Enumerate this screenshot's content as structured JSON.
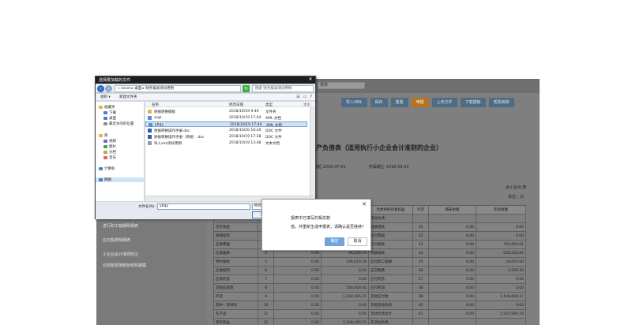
{
  "app": {
    "tab_input": "报表",
    "toolbar": [
      {
        "label": "导入XML",
        "active": false
      },
      {
        "label": "保存",
        "active": false
      },
      {
        "label": "重置",
        "active": false
      },
      {
        "label": "申报",
        "active": true
      },
      {
        "label": "上传文件",
        "active": false
      },
      {
        "label": "下载模板",
        "active": false
      },
      {
        "label": "帮助转换",
        "active": false
      }
    ],
    "left_menu": [
      "进行职工薪酬明细表",
      "应交税费明细表",
      "小企业会计准则附注",
      "应收账款按账龄结构披露"
    ],
    "report_title": "产负债表（适用执行小企业会计准则的企业）",
    "meta": {
      "date": "报期起  2018-07-01",
      "period": "所属期止  2018-09-30",
      "form": "会小企01表",
      "unit": "单位：元"
    },
    "table": {
      "header": [
        "",
        "行次",
        "期末余额",
        "年初余额",
        "负债和所有者权益",
        "行次",
        "期末余额",
        "年初余额"
      ],
      "rows": [
        [
          "",
          "",
          "",
          "",
          "流动负债：",
          "",
          "",
          ""
        ],
        [
          "货币资金",
          "1",
          "",
          "",
          "短期借款",
          "31",
          "0.00",
          "0.00"
        ],
        [
          "短期投资",
          "2",
          "",
          "",
          "应付票据",
          "32",
          "0.00",
          "0.00"
        ],
        [
          "应收票据",
          "3",
          "",
          "",
          "应付账款",
          "33",
          "0.00",
          "750,950.61"
        ],
        [
          "应收账款",
          "4",
          "0.00",
          "96,258.19",
          "预收账款",
          "34",
          "0.00",
          "635,564.81"
        ],
        [
          "预付账款",
          "5",
          "0.00",
          "106,019.19",
          "应付职工薪酬",
          "35",
          "0.00",
          "16,655.00"
        ],
        [
          "应收股利",
          "6",
          "0.00",
          "0.00",
          "应交税费",
          "36",
          "0.00",
          "-1,929.20"
        ],
        [
          "应收利息",
          "7",
          "0.00",
          "0.00",
          "应付利息",
          "37",
          "0.00",
          "0.00"
        ],
        [
          "其他应收款",
          "8",
          "0.00",
          "500,000.00",
          "应付利润",
          "38",
          "0.00",
          "0.00"
        ],
        [
          "存货",
          "9",
          "0.00",
          "1,204,416.15",
          "其他应付款",
          "39",
          "0.00",
          "1,146,699.17"
        ],
        [
          "其中：原材料",
          "10",
          "0.00",
          "0.00",
          "其他流动负债",
          "40",
          "0.00",
          "0.00"
        ],
        [
          "在产品",
          "11",
          "0.00",
          "0.00",
          "流动负债合计",
          "41",
          "0.00",
          "2,547,940.19"
        ],
        [
          "库存商品",
          "12",
          "0.00",
          "1,204,416.15",
          "非流动负债：",
          "",
          "",
          ""
        ]
      ]
    }
  },
  "file_dialog": {
    "title": "选择要加载的文件",
    "address": "« excel ▸ 桌面 ▸ 财务报表测试用例",
    "search_placeholder": "搜索 财务报表测试用例",
    "cmd_organize": "组织 ▾",
    "cmd_newfolder": "新建文件夹",
    "tree": [
      {
        "label": "收藏夹",
        "sel": false,
        "color": "#e7b53c"
      },
      {
        "label": "下载",
        "sel": false,
        "color": "#4a7fc7"
      },
      {
        "label": "桌面",
        "sel": false,
        "color": "#4a7fc7"
      },
      {
        "label": "最近访问的位置",
        "sel": false,
        "color": "#8a8a8a"
      },
      {
        "label": "库",
        "sel": false,
        "color": "#e7b53c"
      },
      {
        "label": "视频",
        "sel": false,
        "color": "#6a6ad0"
      },
      {
        "label": "图片",
        "sel": false,
        "color": "#4aa04a"
      },
      {
        "label": "文档",
        "sel": false,
        "color": "#c7a04a"
      },
      {
        "label": "音乐",
        "sel": false,
        "color": "#d06a6a"
      },
      {
        "label": "计算机",
        "sel": false,
        "color": "#4a7fc7"
      },
      {
        "label": "网络",
        "sel": true,
        "color": "#4a7fc7"
      }
    ],
    "columns": {
      "name": "名称",
      "date": "修改日期",
      "type": "类型",
      "size": "大小"
    },
    "files": [
      {
        "name": "财报转换模板",
        "date": "2018/10/19 9:49",
        "type": "文件夹",
        "icon": "folder",
        "sel": false
      },
      {
        "name": "xsgr",
        "date": "2018/10/19 17:44",
        "type": "XML 文档",
        "icon": "xml",
        "sel": false
      },
      {
        "name": "ybqy",
        "date": "2018/10/19 17:44",
        "type": "XML 文档",
        "icon": "xml",
        "sel": true
      },
      {
        "name": "财报转换操作手册.doc",
        "date": "2018/10/20 16:20",
        "type": "DOC 文件",
        "icon": "doc",
        "sel": false
      },
      {
        "name": "财报转换操作手册（简易）.doc",
        "date": "2018/10/19 17:28",
        "type": "DOC 文件",
        "icon": "doc",
        "sel": false
      },
      {
        "name": "导入xml测试用例",
        "date": "2018/10/19 13:48",
        "type": "文本文档",
        "icon": "txt",
        "sel": false
      }
    ],
    "filename_label": "文件名(N):",
    "filename_value": "ybqy",
    "filetype": "所有文件(*.*)",
    "open_label": "打开(O)",
    "cancel_label": "取消"
  },
  "confirm": {
    "line1": "报表中已填写的相关数",
    "line2": "值，并重新生成申报表，请确认是否继续？",
    "ok": "确定",
    "cancel": "取消"
  }
}
